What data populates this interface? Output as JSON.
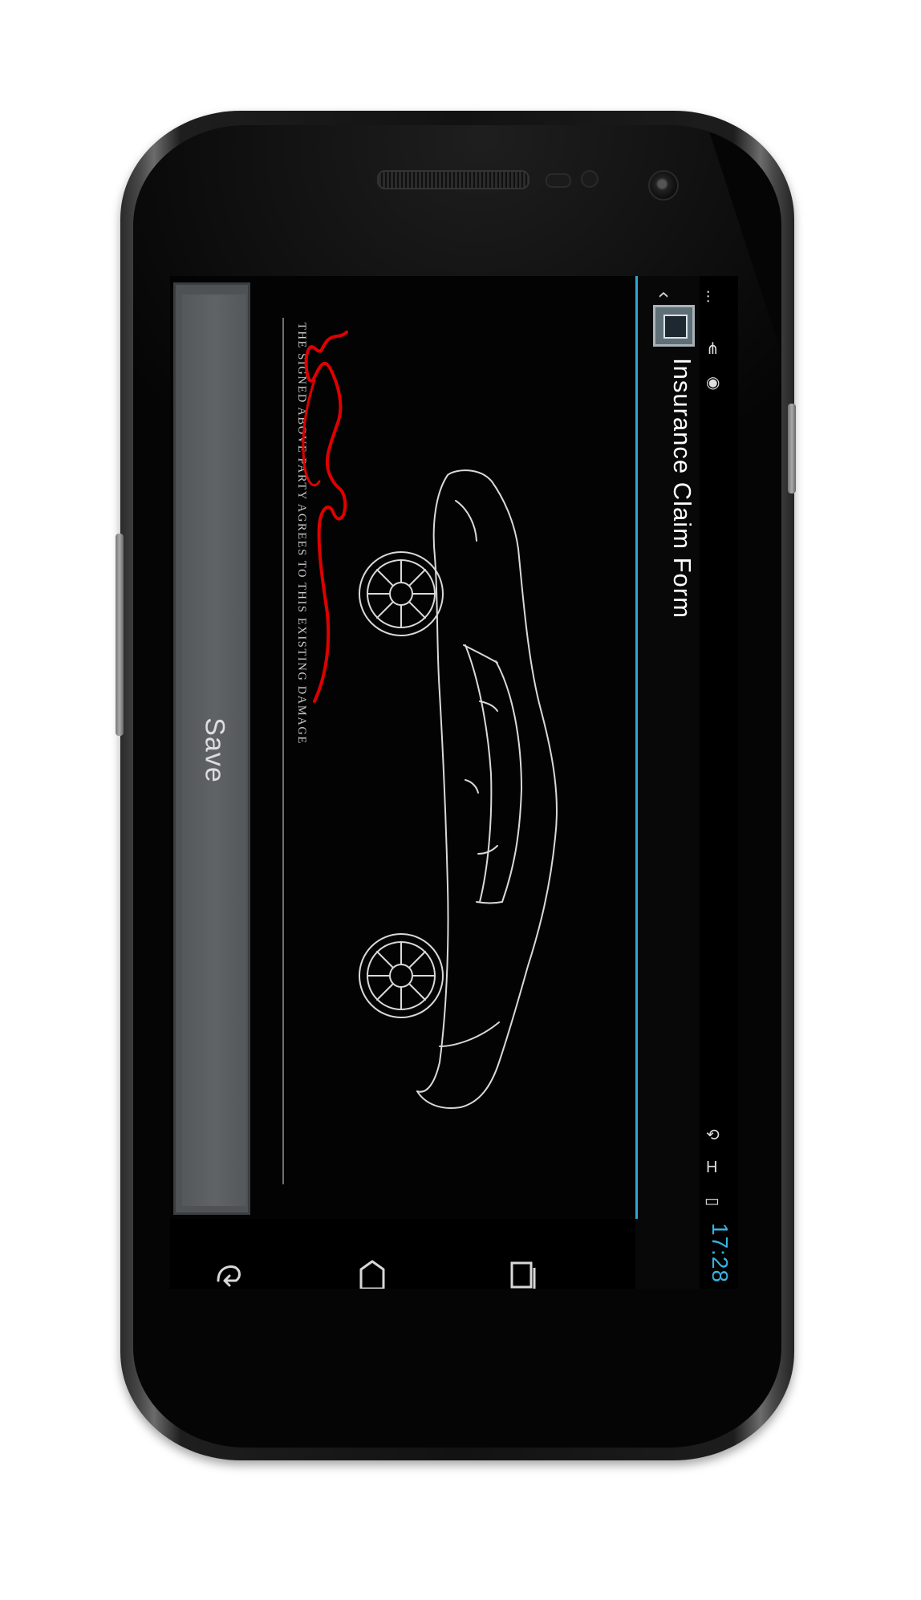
{
  "app": {
    "title": "Insurance Claim Form"
  },
  "form": {
    "agreement_text": "THE SIGNED ABOVE PARTY AGREES TO THIS EXISTING DAMAGE",
    "save_label": "Save"
  },
  "status_bar": {
    "time": "17:28",
    "network_type": "H"
  },
  "navigation": {
    "items": [
      "back",
      "home",
      "recent apps"
    ]
  },
  "colors": {
    "accent": "#35b5e5",
    "signature_ink": "#e00000",
    "button": "#5c5f61"
  }
}
